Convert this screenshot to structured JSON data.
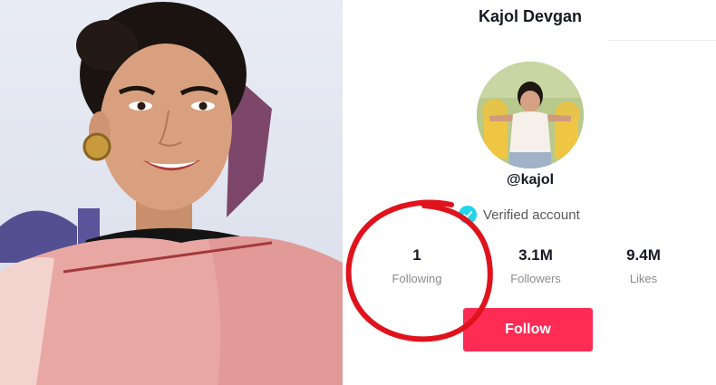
{
  "profile": {
    "display_name": "Kajol Devgan",
    "handle": "@kajol",
    "verified_label": "Verified account",
    "stats": [
      {
        "value": "1",
        "label": "Following"
      },
      {
        "value": "3.1M",
        "label": "Followers"
      },
      {
        "value": "9.4M",
        "label": "Likes"
      }
    ],
    "follow_button_label": "Follow"
  },
  "colors": {
    "follow_button": "#fe2c55",
    "verified_badge": "#20d5ec",
    "annotation_circle": "#e0131d"
  },
  "icons": {
    "verified": "check-badge-icon"
  }
}
